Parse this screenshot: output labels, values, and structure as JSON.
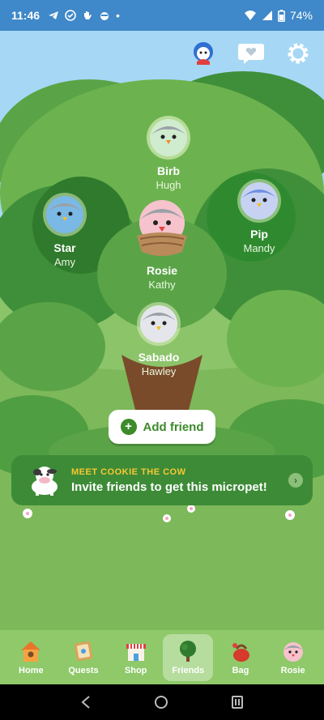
{
  "status_bar": {
    "time": "11:46",
    "battery": "74%"
  },
  "friends": [
    {
      "pet": "Birb",
      "owner": "Hugh",
      "color": "#cfeccf"
    },
    {
      "pet": "Star",
      "owner": "Amy",
      "color": "#7ab9e6"
    },
    {
      "pet": "Rosie",
      "owner": "Kathy",
      "color": "#f6c3cd"
    },
    {
      "pet": "Pip",
      "owner": "Mandy",
      "color": "#c7d2f3"
    },
    {
      "pet": "Sabado",
      "owner": "Hawley",
      "color": "#e4e6ec"
    }
  ],
  "add_friend": {
    "label": "Add friend"
  },
  "promo": {
    "kicker": "MEET COOKIE THE COW",
    "message": "Invite friends to get this micropet!"
  },
  "nav": {
    "items": [
      {
        "label": "Home",
        "icon": "house-icon"
      },
      {
        "label": "Quests",
        "icon": "quest-scroll-icon"
      },
      {
        "label": "Shop",
        "icon": "shop-icon"
      },
      {
        "label": "Friends",
        "icon": "tree-icon"
      },
      {
        "label": "Bag",
        "icon": "bag-icon"
      },
      {
        "label": "Rosie",
        "icon": "pet-avatar-icon"
      }
    ],
    "active": "Friends"
  },
  "colors": {
    "sky": "#a6d8f5",
    "tree_dark": "#3f8f3a",
    "tree_light": "#6cb34f",
    "accent": "#3c8a2a"
  }
}
